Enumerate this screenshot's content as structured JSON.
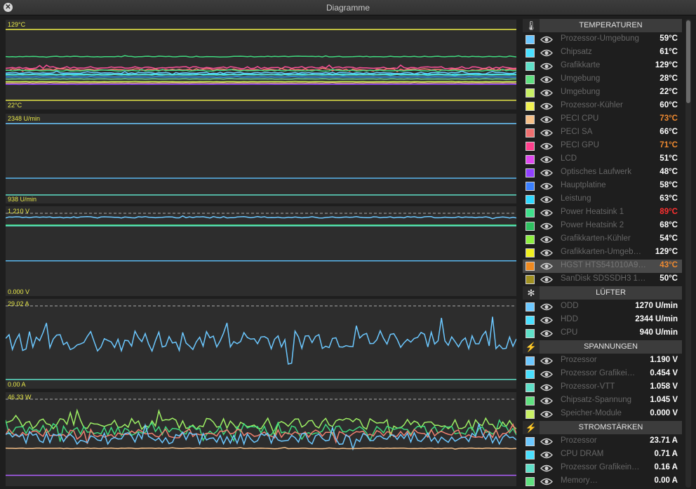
{
  "window": {
    "title": "Diagramme",
    "close_label": "✕"
  },
  "panels": [
    {
      "id": "temp",
      "max_label": "129°C",
      "min_label": "22°C",
      "range": [
        22,
        129
      ],
      "series": [
        {
          "color": "#f0f048",
          "level": 129,
          "noise": 0
        },
        {
          "color": "#3fd97e",
          "level": 88.5,
          "noise": 0.6
        },
        {
          "color": "#ff4f99",
          "level": 72,
          "noise": 1.6
        },
        {
          "color": "#f08070",
          "level": 69,
          "noise": 1.2
        },
        {
          "color": "#3fd97e",
          "level": 67.5,
          "noise": 0.8
        },
        {
          "color": "#6cc8ff",
          "level": 64,
          "noise": 1.0
        },
        {
          "color": "#2fe0ff",
          "level": 62,
          "noise": 0.3
        },
        {
          "color": "#5fe0c8",
          "level": 61,
          "noise": 0.3
        },
        {
          "color": "#3aa0ff",
          "level": 58,
          "noise": 0.2
        },
        {
          "color": "#72e0a0",
          "level": 55,
          "noise": 0.2
        },
        {
          "color": "#c8f050",
          "level": 51,
          "noise": 0.2
        },
        {
          "color": "#f6c088",
          "level": 49,
          "noise": 0.2
        },
        {
          "color": "#9040ff",
          "level": 47,
          "noise": 0.1
        },
        {
          "color": "#e8e84a",
          "level": 23,
          "noise": 0
        }
      ]
    },
    {
      "id": "fans",
      "max_label": "2348 U/min",
      "min_label": "938 U/min",
      "range": [
        938,
        2348
      ],
      "series": [
        {
          "color": "#6cc8ff",
          "level": 2344,
          "noise": 0
        },
        {
          "color": "#5ab8f0",
          "level": 1270,
          "noise": 0
        },
        {
          "color": "#5fe0c8",
          "level": 940,
          "noise": 0
        }
      ]
    },
    {
      "id": "volt",
      "max_label": "1.210 V",
      "min_label": "0.000 V",
      "range": [
        0,
        1.21
      ],
      "dashed_top": true,
      "series": [
        {
          "color": "#6cc8ff",
          "level": 1.19,
          "noise": 0.012
        },
        {
          "color": "#3fd97e",
          "level": 1.058,
          "noise": 0
        },
        {
          "color": "#5fe0c8",
          "level": 1.045,
          "noise": 0
        },
        {
          "color": "#5ab8f0",
          "level": 0.454,
          "noise": 0
        }
      ]
    },
    {
      "id": "amps",
      "max_label": "29.02 A",
      "min_label": "0.00 A",
      "range": [
        0,
        29.02
      ],
      "dashed_top": true,
      "series": [
        {
          "color": "#6cc8ff",
          "level": 16,
          "noise": 4.2
        },
        {
          "color": "#5fe0c8",
          "level": 0.3,
          "noise": 0
        }
      ]
    },
    {
      "id": "power",
      "max_label": "46.33 W",
      "min_label": "",
      "range": [
        0,
        46.33
      ],
      "dashed_top": true,
      "series": [
        {
          "color": "#9ef064",
          "level": 33,
          "noise": 3.5
        },
        {
          "color": "#3fd97e",
          "level": 29,
          "noise": 3.0
        },
        {
          "color": "#f08070",
          "level": 27,
          "noise": 2.8
        },
        {
          "color": "#6cc8ff",
          "level": 24,
          "noise": 3.6
        },
        {
          "color": "#f6c088",
          "level": 18,
          "noise": 0.2
        },
        {
          "color": "#b060ff",
          "level": 1.5,
          "noise": 0
        }
      ]
    }
  ],
  "sections": [
    {
      "icon": "🌡",
      "icon_name": "thermometer-icon",
      "title": "TEMPERATUREN",
      "items": [
        {
          "name": "Prozessor-Umgebung",
          "value": "59°C",
          "color": "#6cc8ff",
          "vcolor": "#ffffff"
        },
        {
          "name": "Chipsatz",
          "value": "61°C",
          "color": "#4ae0ff",
          "vcolor": "#ffffff"
        },
        {
          "name": "Grafikkarte",
          "value": "129°C",
          "color": "#5fe0c8",
          "vcolor": "#ffffff"
        },
        {
          "name": "Umgebung",
          "value": "28°C",
          "color": "#60e080",
          "vcolor": "#ffffff"
        },
        {
          "name": "Umgebung",
          "value": "22°C",
          "color": "#c8f064",
          "vcolor": "#ffffff"
        },
        {
          "name": "Prozessor-Kühler",
          "value": "60°C",
          "color": "#f0f050",
          "vcolor": "#ffffff"
        },
        {
          "name": "PECI CPU",
          "value": "73°C",
          "color": "#f6c088",
          "vcolor": "#f08a30"
        },
        {
          "name": "PECI SA",
          "value": "66°C",
          "color": "#f07070",
          "vcolor": "#ffffff"
        },
        {
          "name": "PECI GPU",
          "value": "71°C",
          "color": "#ff3f8c",
          "vcolor": "#f08a30"
        },
        {
          "name": "LCD",
          "value": "51°C",
          "color": "#e048f0",
          "vcolor": "#ffffff"
        },
        {
          "name": "Optisches Laufwerk",
          "value": "48°C",
          "color": "#9040ff",
          "vcolor": "#ffffff"
        },
        {
          "name": "Hauptplatine",
          "value": "58°C",
          "color": "#3a80ff",
          "vcolor": "#ffffff"
        },
        {
          "name": "Leistung",
          "value": "63°C",
          "color": "#2fd8ff",
          "vcolor": "#ffffff"
        },
        {
          "name": "Power Heatsink 1",
          "value": "89°C",
          "color": "#3fe08c",
          "vcolor": "#ff3030"
        },
        {
          "name": "Power Heatsink 2",
          "value": "68°C",
          "color": "#2fc060",
          "vcolor": "#ffffff"
        },
        {
          "name": "Grafikkarten-Kühler",
          "value": "54°C",
          "color": "#8ef040",
          "vcolor": "#ffffff"
        },
        {
          "name": "Grafikkarten-Umgeb…",
          "value": "129°C",
          "color": "#f0f020",
          "vcolor": "#ffffff"
        },
        {
          "name": "HGST HTS541010A9…",
          "value": "43°C",
          "color": "#f08a20",
          "vcolor": "#f08a30",
          "highlight": true
        },
        {
          "name": "SanDisk SDSSDH3 1…",
          "value": "50°C",
          "color": "#a09020",
          "vcolor": "#ffffff"
        }
      ]
    },
    {
      "icon": "✻",
      "icon_name": "fan-icon",
      "title": "LÜFTER",
      "items": [
        {
          "name": "ODD",
          "value": "1270 U/min",
          "color": "#6cc8ff",
          "vcolor": "#ffffff"
        },
        {
          "name": "HDD",
          "value": "2344 U/min",
          "color": "#4ae0ff",
          "vcolor": "#ffffff"
        },
        {
          "name": "CPU",
          "value": "940 U/min",
          "color": "#5fe0c8",
          "vcolor": "#ffffff"
        }
      ]
    },
    {
      "icon": "⚡",
      "icon_name": "lightning-icon",
      "title": "SPANNUNGEN",
      "items": [
        {
          "name": "Prozessor",
          "value": "1.190 V",
          "color": "#6cc8ff",
          "vcolor": "#ffffff"
        },
        {
          "name": "Prozessor Grafikei…",
          "value": "0.454 V",
          "color": "#4ae0ff",
          "vcolor": "#ffffff"
        },
        {
          "name": "Prozessor-VTT",
          "value": "1.058 V",
          "color": "#5fe0c8",
          "vcolor": "#ffffff"
        },
        {
          "name": "Chipsatz-Spannung",
          "value": "1.045 V",
          "color": "#60e080",
          "vcolor": "#ffffff"
        },
        {
          "name": "Speicher-Module",
          "value": "0.000 V",
          "color": "#c8f064",
          "vcolor": "#ffffff"
        }
      ]
    },
    {
      "icon": "⚡",
      "icon_name": "lightning-icon",
      "title": "STROMSTÄRKEN",
      "items": [
        {
          "name": "Prozessor",
          "value": "23.71 A",
          "color": "#6cc8ff",
          "vcolor": "#ffffff"
        },
        {
          "name": "CPU DRAM",
          "value": "0.71 A",
          "color": "#4ae0ff",
          "vcolor": "#ffffff"
        },
        {
          "name": "Prozessor Grafikein…",
          "value": "0.16 A",
          "color": "#5fe0c8",
          "vcolor": "#ffffff"
        },
        {
          "name": "Memory…",
          "value": "0.00 A",
          "color": "#60e080",
          "vcolor": "#ffffff"
        }
      ]
    }
  ]
}
